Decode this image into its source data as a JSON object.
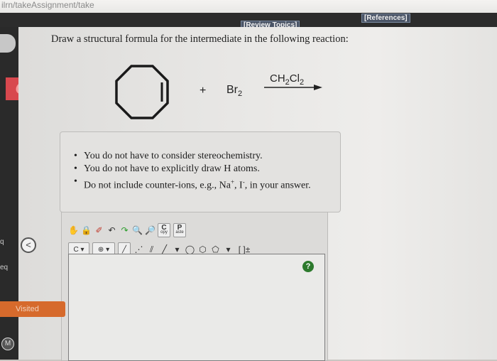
{
  "url": "ilrn/takeAssignment/take",
  "header": {
    "review_topics": "[Review Topics]",
    "references": "[References]"
  },
  "question": "Draw a structural formula for the intermediate in the following reaction:",
  "reaction": {
    "plus": "+",
    "reagent": "Br2",
    "solvent": "CH2Cl2"
  },
  "notes": [
    "You do not have to consider stereochemistry.",
    "You do not have to explicitly draw H atoms.",
    "Do not include counter-ions, e.g., Na+, I-, in your answer."
  ],
  "toolbar": {
    "copy_label": "C",
    "copy_sub": "opy",
    "paste_label": "P",
    "paste_sub": "aste",
    "element_label": "C",
    "bracket_label": "[ ]±",
    "help_label": "?"
  },
  "sidebar": {
    "visited_label": "Visited",
    "label_q": "q",
    "label_eq": "eq",
    "m_label": "M",
    "back_label": "<"
  },
  "logo_text": "OC",
  "colors": {
    "visited": "#d66a2c",
    "help": "#2d7a2d",
    "logo": "#d8484e"
  }
}
